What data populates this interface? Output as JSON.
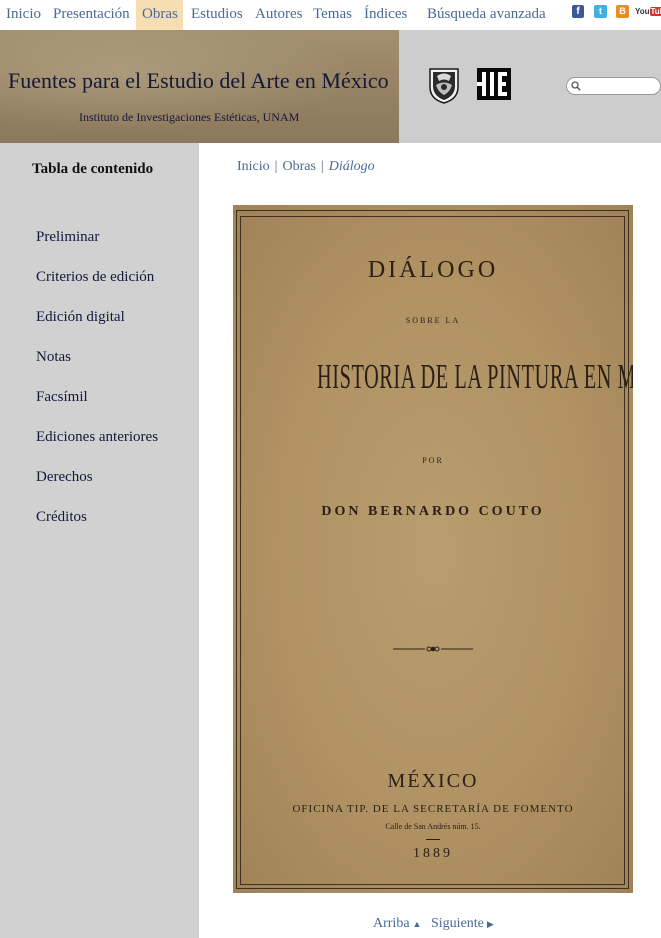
{
  "nav": {
    "items": [
      {
        "label": "Inicio"
      },
      {
        "label": "Presentación"
      },
      {
        "label": "Obras"
      },
      {
        "label": "Estudios"
      },
      {
        "label": "Autores"
      },
      {
        "label": "Temas"
      },
      {
        "label": "Índices"
      },
      {
        "label": "Búsqueda avanzada"
      }
    ],
    "active": "Obras",
    "social": {
      "fb": "f",
      "tw": "t",
      "blog": "B",
      "yt_you": "You",
      "yt_tube": "Tube"
    }
  },
  "header": {
    "title": "Fuentes para el Estudio del Arte en México",
    "subtitle": "Instituto de Investigaciones Estéticas, UNAM",
    "search_placeholder": "",
    "iie_logo_text": "IIE"
  },
  "sidebar": {
    "title": "Tabla de contenido",
    "items": [
      {
        "label": "Preliminar"
      },
      {
        "label": "Criterios de edición"
      },
      {
        "label": "Edición digital"
      },
      {
        "label": "Notas"
      },
      {
        "label": "Facsímil"
      },
      {
        "label": "Ediciones anteriores"
      },
      {
        "label": "Derechos"
      },
      {
        "label": "Créditos"
      }
    ]
  },
  "breadcrumb": {
    "items": [
      "Inicio",
      "Obras"
    ],
    "separator": "|",
    "current": "Diálogo"
  },
  "facsimile": {
    "title": "DIÁLOGO",
    "sobre": "SOBRE LA",
    "historia": "HISTORIA DE LA PINTURA EN MÉXICO",
    "por": "POR",
    "author": "DON BERNARDO COUTO",
    "city": "MÉXICO",
    "publisher": "OFICINA TIP. DE LA SECRETARÍA DE FOMENTO",
    "address": "Calle de San Andrés núm. 15.",
    "year": "1889"
  },
  "pager": {
    "up": "Arriba",
    "up_arrow": "▲",
    "next": "Siguiente",
    "next_arrow": "▶"
  },
  "colors": {
    "link": "#4a6a94",
    "active_tab": "#f6ddb2",
    "sidebar_bg": "#d1d1d1",
    "header_bg": "#cdcdcd",
    "title_text": "#14183a"
  }
}
